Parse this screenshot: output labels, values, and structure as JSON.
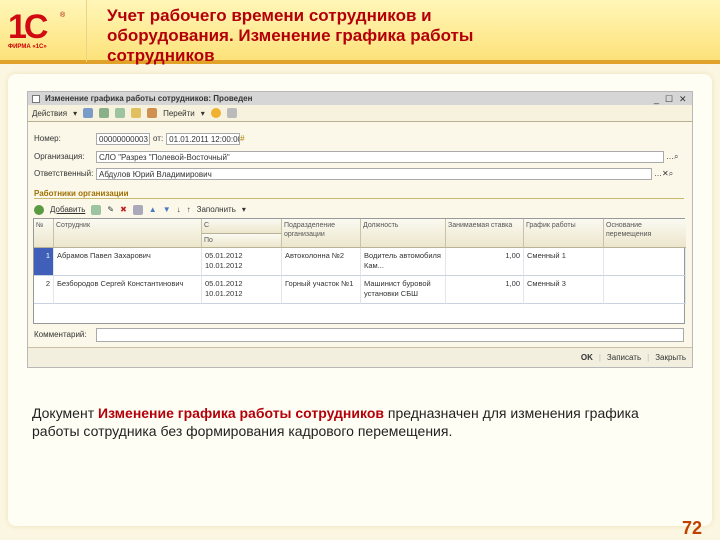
{
  "slide": {
    "title": "Учет рабочего времени сотрудников и оборудования. Изменение графика работы сотрудников",
    "logo_mark": "1С",
    "logo_sub": "ФИРМА «1С»",
    "page_number": "72",
    "desc_pre": "Документ ",
    "desc_bold": "Изменение графика работы сотрудников",
    "desc_post": " предназначен для изменения графика работы сотрудника без формирования кадрового перемещения."
  },
  "window": {
    "title": "Изменение графика работы сотрудников: Проведен",
    "toolbar": {
      "actions": "Действия",
      "goto": "Перейти"
    },
    "fields": {
      "number_label": "Номер:",
      "number": "00000000003",
      "from_label": "от:",
      "date": "01.01.2011 12:00:00",
      "org_label": "Организация:",
      "org": "СЛО \"Разрез \"Полевой-Восточный\"",
      "resp_label": "Ответственный:",
      "resp": "Абдулов Юрий Владимирович"
    },
    "section": "Работники организации",
    "table_toolbar": {
      "add": "Добавить",
      "fill": "Заполнить"
    },
    "columns": [
      "№",
      "Сотрудник",
      "С",
      "По",
      "Подразделение организации",
      "Должность",
      "Занимаемая ставка",
      "График работы",
      "Основание перемещения"
    ],
    "rows": [
      {
        "n": "1",
        "employee": "Абрамов Павел Захарович",
        "from": "05.01.2012",
        "to": "10.01.2012",
        "dept": "Автоколонна №2",
        "position": "Водитель автомобиля Кам...",
        "rate": "1,00",
        "schedule": "Сменный 1",
        "basis": ""
      },
      {
        "n": "2",
        "employee": "Безбородов Сергей Константинович",
        "from": "05.01.2012",
        "to": "10.01.2012",
        "dept": "Горный участок №1",
        "position": "Машинист буровой установки СБШ",
        "rate": "1,00",
        "schedule": "Сменный 3",
        "basis": ""
      }
    ],
    "comment_label": "Комментарий:",
    "comment": "",
    "buttons": {
      "ok": "OK",
      "save": "Записать",
      "close": "Закрыть"
    }
  },
  "colors": {
    "accent": "#b4000a"
  }
}
